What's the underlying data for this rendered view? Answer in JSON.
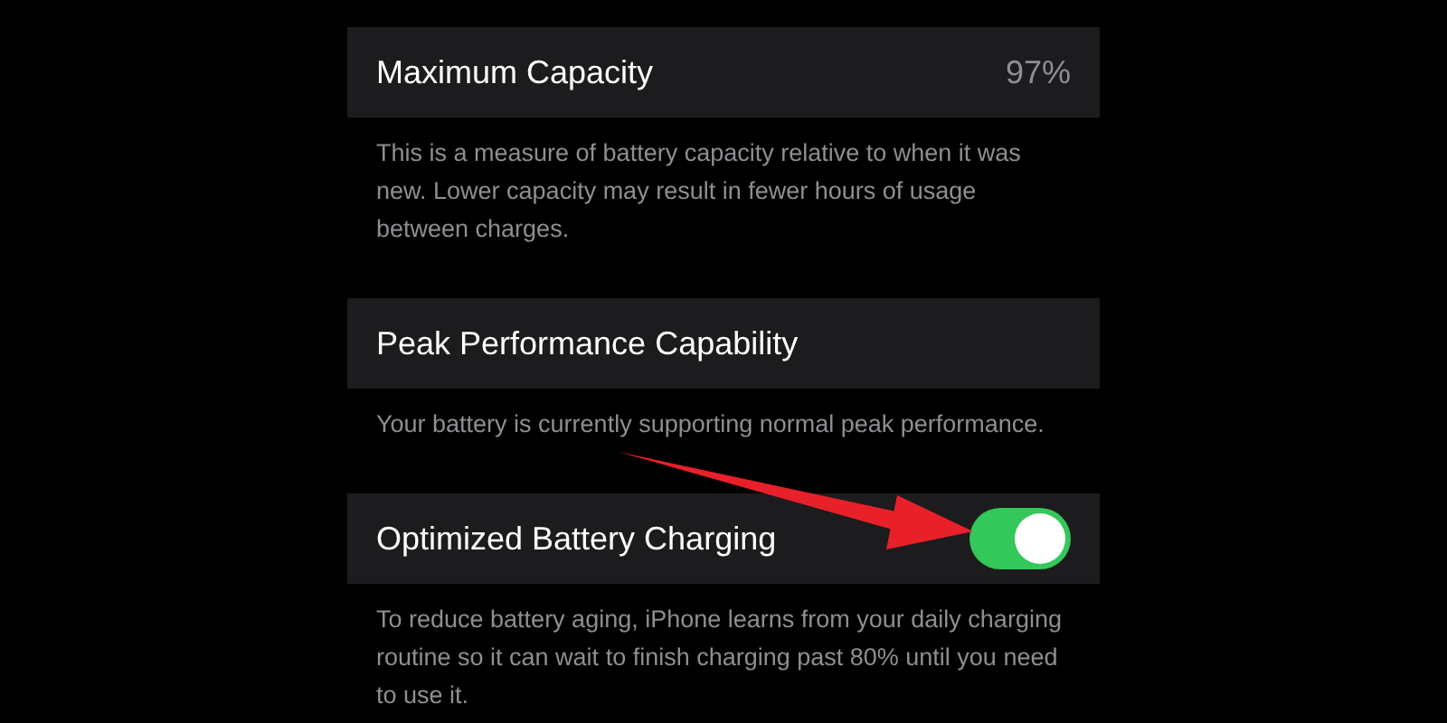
{
  "sections": [
    {
      "kind": "value",
      "title": "Maximum Capacity",
      "value": "97%",
      "description": "This is a measure of battery capacity relative to when it was new. Lower capacity may result in fewer hours of usage between charges."
    },
    {
      "kind": "plain",
      "title": "Peak Performance Capability",
      "description": "Your battery is currently supporting normal peak performance."
    },
    {
      "kind": "toggle",
      "title": "Optimized Battery Charging",
      "on": true,
      "description": "To reduce battery aging, iPhone learns from your daily charging routine so it can wait to finish charging past 80% until you need to use it."
    }
  ]
}
